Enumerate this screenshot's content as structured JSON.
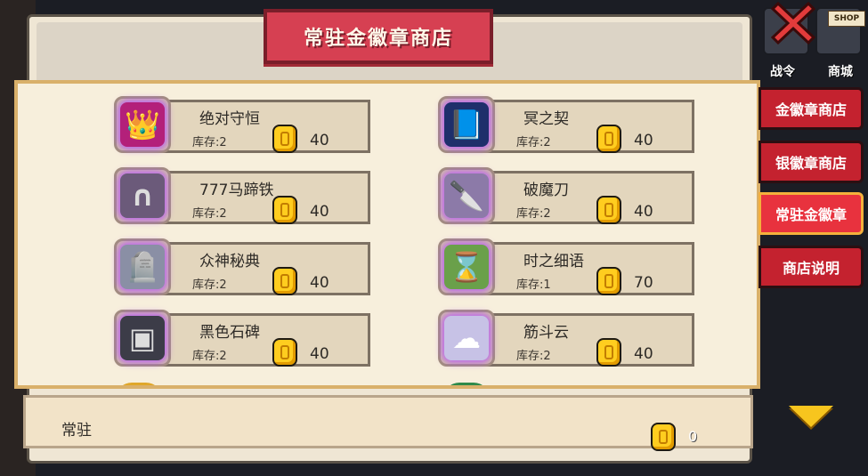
{
  "shop": {
    "title": "常驻金徽章商店",
    "bottom_label": "常驻",
    "currency_owned": "0"
  },
  "items": [
    {
      "name": "绝对守恒",
      "stock": "库存:2",
      "price": "40",
      "icon": "crown-icon",
      "glyph": "👑",
      "bg": "#b3207a"
    },
    {
      "name": "冥之契",
      "stock": "库存:2",
      "price": "40",
      "icon": "book-icon",
      "glyph": "📘",
      "bg": "#1e2f6b"
    },
    {
      "name": "777马蹄铁",
      "stock": "库存:2",
      "price": "40",
      "icon": "horseshoe-icon",
      "glyph": "∩",
      "bg": "#6b5a7a"
    },
    {
      "name": "破魔刀",
      "stock": "库存:2",
      "price": "40",
      "icon": "blade-icon",
      "glyph": "🔪",
      "bg": "#8c7aa8"
    },
    {
      "name": "众神秘典",
      "stock": "库存:2",
      "price": "40",
      "icon": "tombstone-icon",
      "glyph": "🪦",
      "bg": "#8a8fa5"
    },
    {
      "name": "时之细语",
      "stock": "库存:1",
      "price": "70",
      "icon": "hourglass-icon",
      "glyph": "⌛",
      "bg": "#6aa04a"
    },
    {
      "name": "黑色石碑",
      "stock": "库存:2",
      "price": "40",
      "icon": "monolith-icon",
      "glyph": "▣",
      "bg": "#3c3c48"
    },
    {
      "name": "筋斗云",
      "stock": "库存:2",
      "price": "40",
      "icon": "cloud-icon",
      "glyph": "☁",
      "bg": "#c7c2e6"
    }
  ],
  "side_tabs": [
    {
      "label": "金徽章商店",
      "active": false
    },
    {
      "label": "银徽章商店",
      "active": false
    },
    {
      "label": "常驻金徽章",
      "active": true
    },
    {
      "label": "商店说明",
      "active": false
    }
  ],
  "top_icons": {
    "battle_pass_label": "战令",
    "mall_label": "商城",
    "shop_sign": "SHOP"
  },
  "colors": {
    "title_banner": "#d64052",
    "side_tab": "#c4222f",
    "coin": "#ffcd1f",
    "panel_border": "#d9b06a"
  }
}
